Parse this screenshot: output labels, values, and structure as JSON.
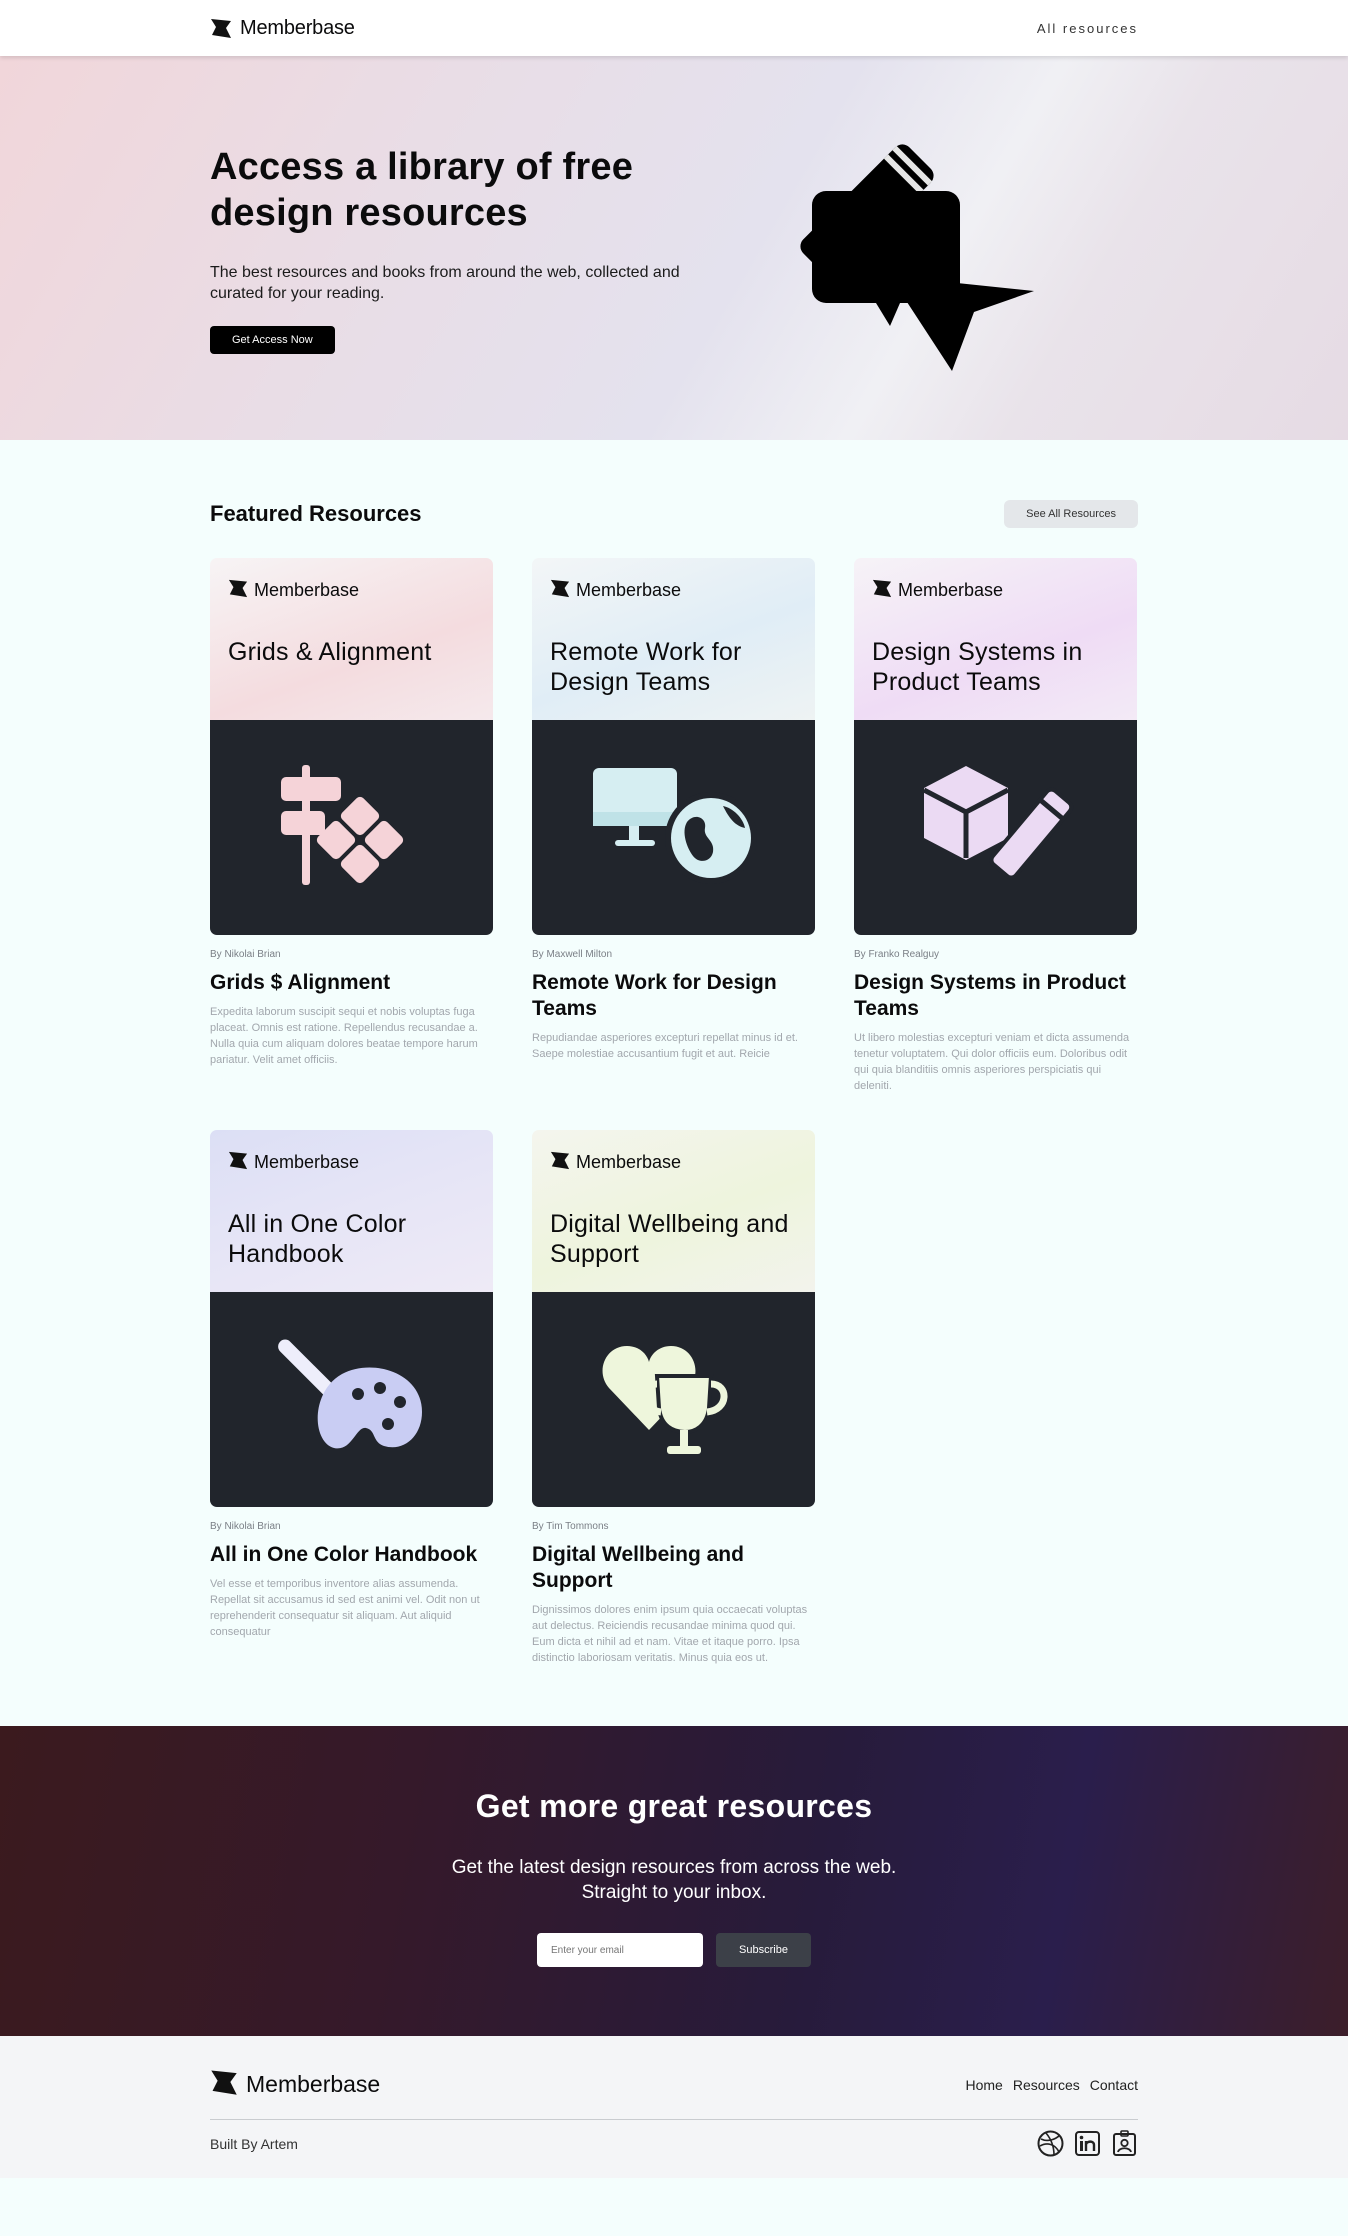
{
  "nav": {
    "brand": "Memberbase",
    "link": "All resources"
  },
  "hero": {
    "title": "Access a library of free design resources",
    "subtitle": "The best resources and books from around the web, collected and curated for your reading.",
    "cta": "Get Access Now"
  },
  "featured": {
    "title": "Featured Resources",
    "see_all": "See All Resources",
    "cards": [
      {
        "cover_brand": "Memberbase",
        "cover_title": "Grids & Alignment",
        "author": "By Nikolai Brian",
        "title": "Grids $ Alignment",
        "desc": "Expedita laborum suscipit sequi et nobis voluptas fuga placeat. Omnis est ratione. Repellendus recusandae a. Nulla quia cum aliquam dolores beatae tempore harum pariatur. Velit amet officiis.",
        "icon": "align-icon",
        "accent": "#f5d3d8"
      },
      {
        "cover_brand": "Memberbase",
        "cover_title": "Remote Work for Design Teams",
        "author": "By Maxwell Milton",
        "title": "Remote Work for Design Teams",
        "desc": "Repudiandae asperiores excepturi repellat minus id et. Saepe molestiae accusantium fugit et aut. Reicie",
        "icon": "monitor-globe-icon",
        "accent": "#cfe8ef"
      },
      {
        "cover_brand": "Memberbase",
        "cover_title": "Design Systems in Product Teams",
        "author": "By Franko Realguy",
        "title": "Design Systems in Product Teams",
        "desc": "Ut libero molestias excepturi veniam et dicta assumenda tenetur voluptatem. Qui dolor officiis eum. Doloribus odit qui quia blanditiis omnis asperiores perspiciatis qui deleniti.",
        "icon": "cube-pencil-icon",
        "accent": "#ebdaf3"
      },
      {
        "cover_brand": "Memberbase",
        "cover_title": "All in One Color Handbook",
        "author": "By Nikolai Brian",
        "title": "All in One Color Handbook",
        "desc": "Vel esse et temporibus inventore alias assumenda. Repellat sit accusamus id sed est animi vel. Odit non ut reprehenderit consequatur sit aliquam. Aut aliquid consequatur",
        "icon": "palette-brush-icon",
        "accent": "#c9cdf3"
      },
      {
        "cover_brand": "Memberbase",
        "cover_title": "Digital Wellbeing and Support",
        "author": "By Tim Tommons",
        "title": "Digital Wellbeing and Support",
        "desc": "Dignissimos dolores enim ipsum quia occaecati voluptas aut delectus. Reiciendis recusandae minima quod qui. Eum dicta et nihil ad et nam. Vitae et itaque porro. Ipsa distinctio laboriosam veritatis. Minus quia eos ut.",
        "icon": "heart-trophy-icon",
        "accent": "#eef6dc"
      }
    ]
  },
  "newsletter": {
    "title": "Get more great resources",
    "subtitle_line1": "Get the latest design resources from across the web.",
    "subtitle_line2": "Straight to your inbox.",
    "placeholder": "Enter your email",
    "button": "Subscribe"
  },
  "footer": {
    "brand": "Memberbase",
    "links": [
      "Home",
      "Resources",
      "Contact"
    ],
    "built_by": "Built By Artem",
    "socials": [
      "dribbble-icon",
      "linkedin-icon",
      "user-badge-icon"
    ]
  }
}
